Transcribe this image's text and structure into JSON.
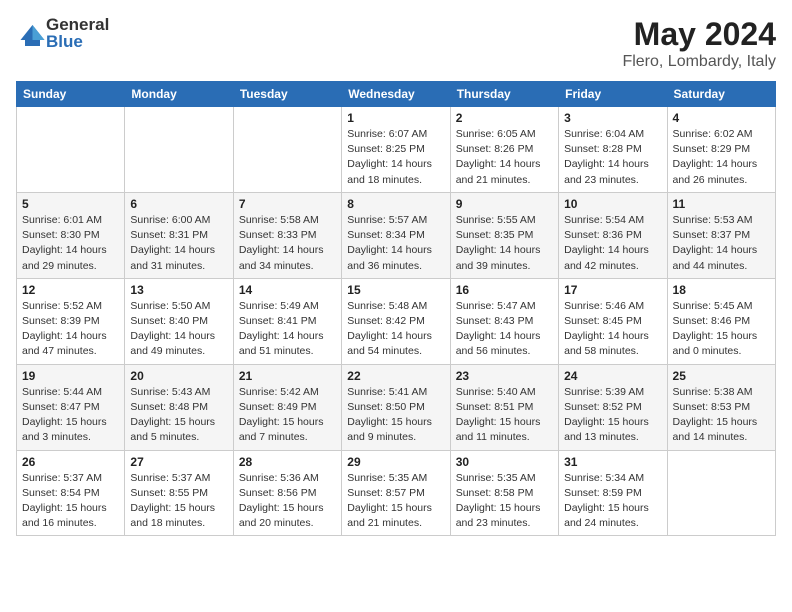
{
  "header": {
    "logo_general": "General",
    "logo_blue": "Blue",
    "month": "May 2024",
    "location": "Flero, Lombardy, Italy"
  },
  "weekdays": [
    "Sunday",
    "Monday",
    "Tuesday",
    "Wednesday",
    "Thursday",
    "Friday",
    "Saturday"
  ],
  "weeks": [
    [
      {
        "day": "",
        "sunrise": "",
        "sunset": "",
        "daylight": ""
      },
      {
        "day": "",
        "sunrise": "",
        "sunset": "",
        "daylight": ""
      },
      {
        "day": "",
        "sunrise": "",
        "sunset": "",
        "daylight": ""
      },
      {
        "day": "1",
        "sunrise": "Sunrise: 6:07 AM",
        "sunset": "Sunset: 8:25 PM",
        "daylight": "Daylight: 14 hours and 18 minutes."
      },
      {
        "day": "2",
        "sunrise": "Sunrise: 6:05 AM",
        "sunset": "Sunset: 8:26 PM",
        "daylight": "Daylight: 14 hours and 21 minutes."
      },
      {
        "day": "3",
        "sunrise": "Sunrise: 6:04 AM",
        "sunset": "Sunset: 8:28 PM",
        "daylight": "Daylight: 14 hours and 23 minutes."
      },
      {
        "day": "4",
        "sunrise": "Sunrise: 6:02 AM",
        "sunset": "Sunset: 8:29 PM",
        "daylight": "Daylight: 14 hours and 26 minutes."
      }
    ],
    [
      {
        "day": "5",
        "sunrise": "Sunrise: 6:01 AM",
        "sunset": "Sunset: 8:30 PM",
        "daylight": "Daylight: 14 hours and 29 minutes."
      },
      {
        "day": "6",
        "sunrise": "Sunrise: 6:00 AM",
        "sunset": "Sunset: 8:31 PM",
        "daylight": "Daylight: 14 hours and 31 minutes."
      },
      {
        "day": "7",
        "sunrise": "Sunrise: 5:58 AM",
        "sunset": "Sunset: 8:33 PM",
        "daylight": "Daylight: 14 hours and 34 minutes."
      },
      {
        "day": "8",
        "sunrise": "Sunrise: 5:57 AM",
        "sunset": "Sunset: 8:34 PM",
        "daylight": "Daylight: 14 hours and 36 minutes."
      },
      {
        "day": "9",
        "sunrise": "Sunrise: 5:55 AM",
        "sunset": "Sunset: 8:35 PM",
        "daylight": "Daylight: 14 hours and 39 minutes."
      },
      {
        "day": "10",
        "sunrise": "Sunrise: 5:54 AM",
        "sunset": "Sunset: 8:36 PM",
        "daylight": "Daylight: 14 hours and 42 minutes."
      },
      {
        "day": "11",
        "sunrise": "Sunrise: 5:53 AM",
        "sunset": "Sunset: 8:37 PM",
        "daylight": "Daylight: 14 hours and 44 minutes."
      }
    ],
    [
      {
        "day": "12",
        "sunrise": "Sunrise: 5:52 AM",
        "sunset": "Sunset: 8:39 PM",
        "daylight": "Daylight: 14 hours and 47 minutes."
      },
      {
        "day": "13",
        "sunrise": "Sunrise: 5:50 AM",
        "sunset": "Sunset: 8:40 PM",
        "daylight": "Daylight: 14 hours and 49 minutes."
      },
      {
        "day": "14",
        "sunrise": "Sunrise: 5:49 AM",
        "sunset": "Sunset: 8:41 PM",
        "daylight": "Daylight: 14 hours and 51 minutes."
      },
      {
        "day": "15",
        "sunrise": "Sunrise: 5:48 AM",
        "sunset": "Sunset: 8:42 PM",
        "daylight": "Daylight: 14 hours and 54 minutes."
      },
      {
        "day": "16",
        "sunrise": "Sunrise: 5:47 AM",
        "sunset": "Sunset: 8:43 PM",
        "daylight": "Daylight: 14 hours and 56 minutes."
      },
      {
        "day": "17",
        "sunrise": "Sunrise: 5:46 AM",
        "sunset": "Sunset: 8:45 PM",
        "daylight": "Daylight: 14 hours and 58 minutes."
      },
      {
        "day": "18",
        "sunrise": "Sunrise: 5:45 AM",
        "sunset": "Sunset: 8:46 PM",
        "daylight": "Daylight: 15 hours and 0 minutes."
      }
    ],
    [
      {
        "day": "19",
        "sunrise": "Sunrise: 5:44 AM",
        "sunset": "Sunset: 8:47 PM",
        "daylight": "Daylight: 15 hours and 3 minutes."
      },
      {
        "day": "20",
        "sunrise": "Sunrise: 5:43 AM",
        "sunset": "Sunset: 8:48 PM",
        "daylight": "Daylight: 15 hours and 5 minutes."
      },
      {
        "day": "21",
        "sunrise": "Sunrise: 5:42 AM",
        "sunset": "Sunset: 8:49 PM",
        "daylight": "Daylight: 15 hours and 7 minutes."
      },
      {
        "day": "22",
        "sunrise": "Sunrise: 5:41 AM",
        "sunset": "Sunset: 8:50 PM",
        "daylight": "Daylight: 15 hours and 9 minutes."
      },
      {
        "day": "23",
        "sunrise": "Sunrise: 5:40 AM",
        "sunset": "Sunset: 8:51 PM",
        "daylight": "Daylight: 15 hours and 11 minutes."
      },
      {
        "day": "24",
        "sunrise": "Sunrise: 5:39 AM",
        "sunset": "Sunset: 8:52 PM",
        "daylight": "Daylight: 15 hours and 13 minutes."
      },
      {
        "day": "25",
        "sunrise": "Sunrise: 5:38 AM",
        "sunset": "Sunset: 8:53 PM",
        "daylight": "Daylight: 15 hours and 14 minutes."
      }
    ],
    [
      {
        "day": "26",
        "sunrise": "Sunrise: 5:37 AM",
        "sunset": "Sunset: 8:54 PM",
        "daylight": "Daylight: 15 hours and 16 minutes."
      },
      {
        "day": "27",
        "sunrise": "Sunrise: 5:37 AM",
        "sunset": "Sunset: 8:55 PM",
        "daylight": "Daylight: 15 hours and 18 minutes."
      },
      {
        "day": "28",
        "sunrise": "Sunrise: 5:36 AM",
        "sunset": "Sunset: 8:56 PM",
        "daylight": "Daylight: 15 hours and 20 minutes."
      },
      {
        "day": "29",
        "sunrise": "Sunrise: 5:35 AM",
        "sunset": "Sunset: 8:57 PM",
        "daylight": "Daylight: 15 hours and 21 minutes."
      },
      {
        "day": "30",
        "sunrise": "Sunrise: 5:35 AM",
        "sunset": "Sunset: 8:58 PM",
        "daylight": "Daylight: 15 hours and 23 minutes."
      },
      {
        "day": "31",
        "sunrise": "Sunrise: 5:34 AM",
        "sunset": "Sunset: 8:59 PM",
        "daylight": "Daylight: 15 hours and 24 minutes."
      },
      {
        "day": "",
        "sunrise": "",
        "sunset": "",
        "daylight": ""
      }
    ]
  ]
}
